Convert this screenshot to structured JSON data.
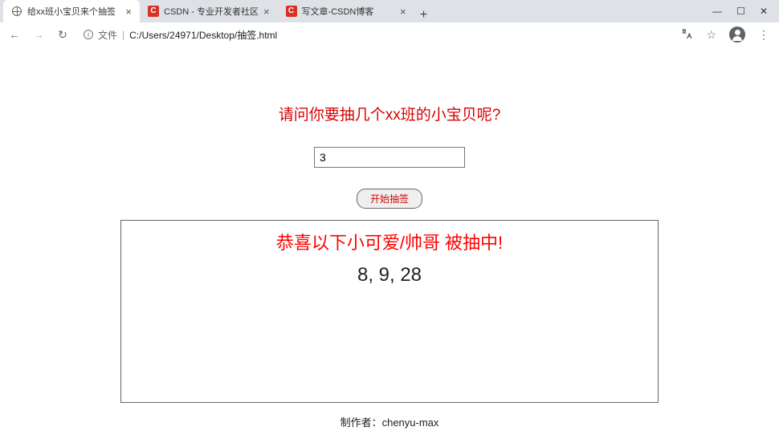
{
  "browser": {
    "tabs": [
      {
        "title": "给xx班小宝贝来个抽签",
        "favicon": "globe",
        "active": true
      },
      {
        "title": "CSDN - 专业开发者社区",
        "favicon": "csdn",
        "active": false
      },
      {
        "title": "写文章-CSDN博客",
        "favicon": "csdn",
        "active": false
      }
    ],
    "new_tab": "+",
    "window": {
      "min": "—",
      "max": "☐",
      "close": "✕"
    },
    "nav": {
      "back": "←",
      "forward": "→",
      "reload": "↻"
    },
    "url_label": "文件",
    "url_path": "C:/Users/24971/Desktop/抽签.html",
    "icons": {
      "translate": "⠿",
      "star": "☆",
      "menu": "⋮"
    }
  },
  "page": {
    "prompt": "请问你要抽几个xx班的小宝贝呢?",
    "input_value": "3",
    "button_label": "开始抽签",
    "congrats": "恭喜以下小可爱/帅哥 被抽中!",
    "result_numbers": "8, 9, 28",
    "footer": "制作者：chenyu-max"
  }
}
